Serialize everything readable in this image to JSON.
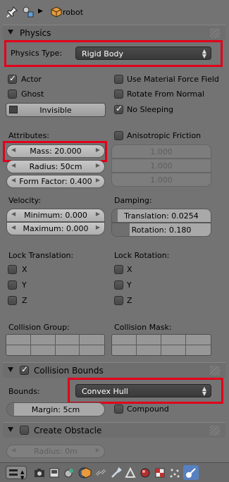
{
  "breadcrumb": {
    "object_name": "robot"
  },
  "panels": {
    "physics": {
      "title": "Physics"
    },
    "collision_bounds": {
      "title": "Collision Bounds"
    },
    "create_obstacle": {
      "title": "Create Obstacle"
    }
  },
  "physics": {
    "type_label": "Physics Type:",
    "type_value": "Rigid Body",
    "checkboxes": {
      "actor": {
        "label": "Actor",
        "checked": true
      },
      "ghost": {
        "label": "Ghost",
        "checked": false
      },
      "use_material_force_field": {
        "label": "Use Material Force Field",
        "checked": false
      },
      "rotate_from_normal": {
        "label": "Rotate From Normal",
        "checked": false
      },
      "no_sleeping": {
        "label": "No Sleeping",
        "checked": true
      },
      "anisotropic_friction": {
        "label": "Anisotropic Friction",
        "checked": false
      }
    },
    "invisible_label": "Invisible",
    "attributes_label": "Attributes:",
    "mass": "Mass: 20.000",
    "radius": "Radius: 50cm",
    "form_factor": "Form Factor: 0.400",
    "aniso_values": [
      "1.000",
      "1.000",
      "1.000"
    ],
    "velocity_label": "Velocity:",
    "velocity_min": "Minimum: 0.000",
    "velocity_max": "Maximum: 0.000",
    "damping_label": "Damping:",
    "damping_translation": "Translation: 0.0254",
    "damping_rotation": "Rotation: 0.180",
    "damping_translation_fraction": 0.0254,
    "damping_rotation_fraction": 0.18,
    "lock_translation_label": "Lock Translation:",
    "lock_rotation_label": "Lock Rotation:",
    "axes": [
      "X",
      "Y",
      "Z"
    ],
    "collision_group_label": "Collision Group:",
    "collision_mask_label": "Collision Mask:"
  },
  "collision_bounds": {
    "enabled": true,
    "bounds_label": "Bounds:",
    "bounds_value": "Convex Hull",
    "margin": "Margin: 5cm",
    "compound_label": "Compound"
  },
  "create_obstacle": {
    "enabled": false,
    "radius": "Radius: 0m"
  },
  "colors": {
    "background": "#737373",
    "highlight": "#e1001a",
    "dropdown": "#3f3f3f"
  },
  "property_tabs_icons": [
    "render-icon",
    "render-layers-icon",
    "scene-icon",
    "world-icon",
    "object-icon",
    "constraints-icon",
    "modifiers-icon",
    "data-icon",
    "material-icon",
    "texture-icon",
    "particles-icon",
    "physics-icon"
  ]
}
